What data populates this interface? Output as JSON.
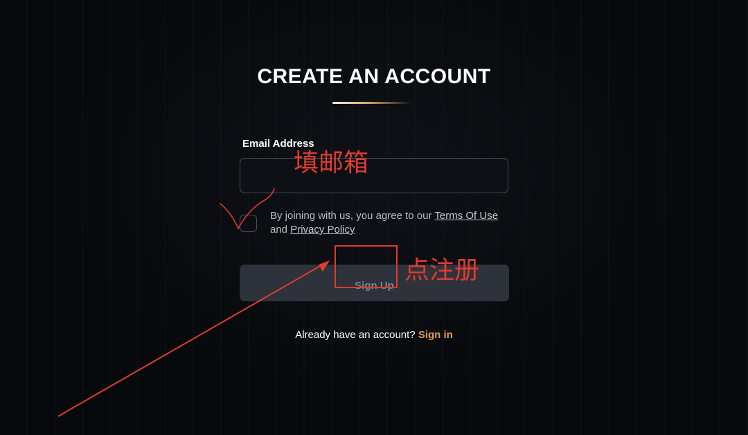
{
  "page": {
    "title": "CREATE AN ACCOUNT"
  },
  "form": {
    "email_label": "Email Address",
    "email_value": "",
    "terms_prefix": "By joining with us, you agree to our",
    "terms_link": "Terms Of Use",
    "terms_and": "and",
    "privacy_link": "Privacy Policy",
    "signup_label": "Sign Up",
    "checkbox_checked": false
  },
  "footer": {
    "prompt": "Already have an account?",
    "signin_label": "Sign in"
  },
  "annotations": {
    "email_hint": "填邮箱",
    "signup_hint": "点注册"
  },
  "colors": {
    "background": "#07090c",
    "accent": "#e39a55",
    "annotation": "#e13b2f",
    "button_bg": "#2d323b",
    "button_text": "#7e8591"
  }
}
